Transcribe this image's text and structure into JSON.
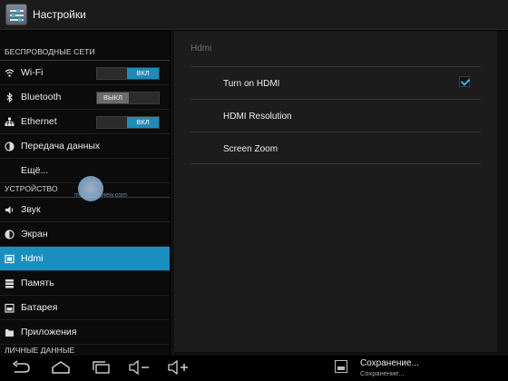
{
  "app": {
    "title": "Настройки",
    "icon": "settings-icon"
  },
  "sidebar": {
    "sections": [
      {
        "header": "БЕСПРОВОДНЫЕ СЕТИ"
      },
      {
        "header": "УСТРОЙСТВО"
      },
      {
        "header": "ЛИЧНЫЕ ДАННЫЕ"
      }
    ],
    "items": [
      {
        "label": "Wi-Fi",
        "icon": "wifi-icon",
        "toggle": "ВКЛ",
        "toggle_state": "on"
      },
      {
        "label": "Bluetooth",
        "icon": "bluetooth-icon",
        "toggle": "ВЫКЛ",
        "toggle_state": "off"
      },
      {
        "label": "Ethernet",
        "icon": "ethernet-icon",
        "toggle": "ВКЛ",
        "toggle_state": "on"
      },
      {
        "label": "Передача данных",
        "icon": "data-usage-icon"
      },
      {
        "label": "Ещё..."
      },
      {
        "label": "Звук",
        "icon": "sound-icon"
      },
      {
        "label": "Экран",
        "icon": "display-icon"
      },
      {
        "label": "Hdmi",
        "icon": "hdmi-icon",
        "selected": true
      },
      {
        "label": "Память",
        "icon": "storage-icon"
      },
      {
        "label": "Батарея",
        "icon": "battery-icon"
      },
      {
        "label": "Приложения",
        "icon": "apps-icon"
      }
    ],
    "watermark": "mobile-review.com"
  },
  "panel": {
    "header": "Hdmi",
    "items": [
      {
        "label": "Turn on HDMI",
        "checked": true
      },
      {
        "label": "HDMI Resolution"
      },
      {
        "label": "Screen Zoom"
      }
    ]
  },
  "navbar": {
    "buttons": [
      "back-icon",
      "home-icon",
      "recent-apps-icon",
      "volume-down-icon",
      "volume-up-icon"
    ],
    "notification": {
      "title": "Сохранение...",
      "subtitle": "Сохранение...",
      "icon": "image-icon"
    }
  },
  "colors": {
    "accent": "#33b5e5",
    "selected_bg": "#1a8fbf",
    "toggle_on": "#1e8bb8"
  }
}
